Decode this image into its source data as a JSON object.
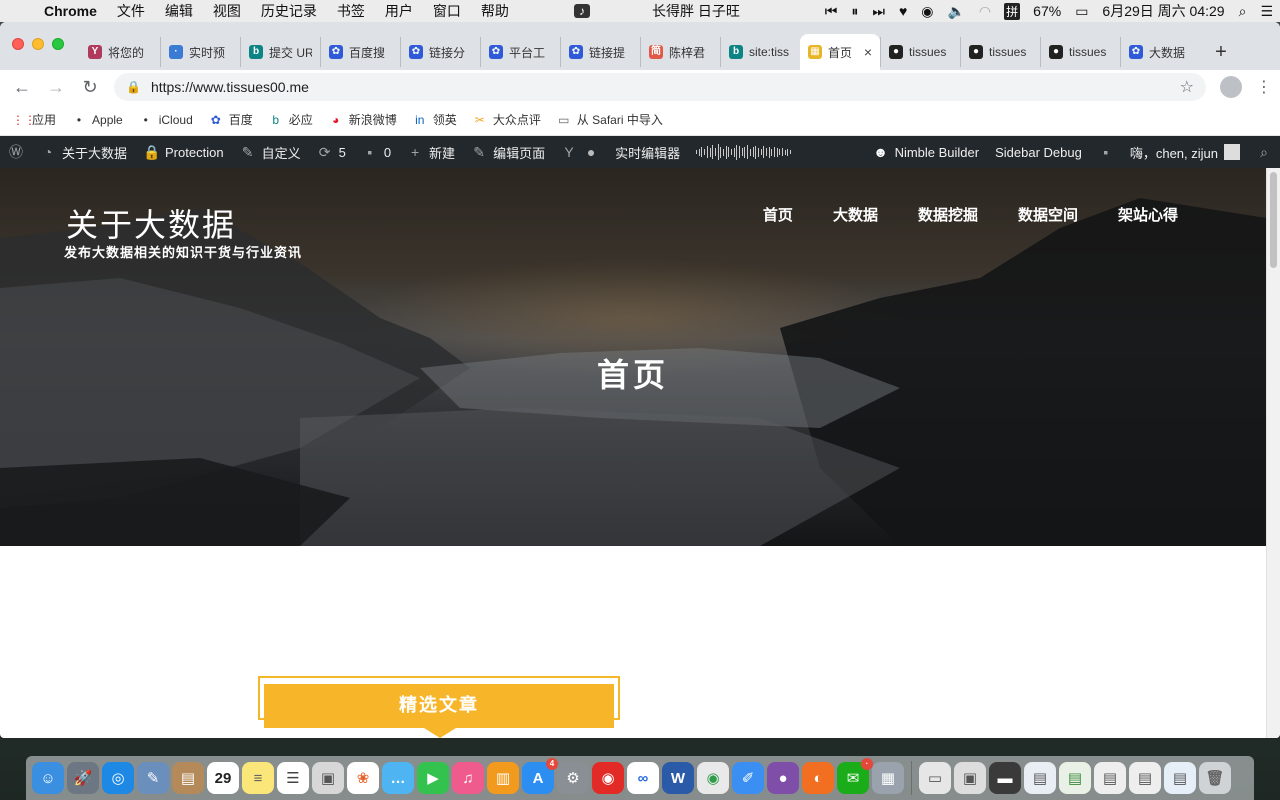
{
  "menubar": {
    "app": "Chrome",
    "menus": [
      "文件",
      "编辑",
      "视图",
      "历史记录",
      "书签",
      "用户",
      "窗口",
      "帮助"
    ],
    "now_playing": "长得胖 日子旺",
    "battery": "67%",
    "date_time": "6月29日 周六  04:29",
    "input_method": "拼"
  },
  "tabs": [
    {
      "title": "将您的",
      "fav": "Y",
      "color": "#b03a5b"
    },
    {
      "title": "实时预",
      "fav": "·",
      "color": "#3a7bd5"
    },
    {
      "title": "提交 UR",
      "fav": "b",
      "color": "#0c8484"
    },
    {
      "title": "百度搜",
      "fav": "✿",
      "color": "#2f5bd8"
    },
    {
      "title": "链接分",
      "fav": "✿",
      "color": "#2f5bd8"
    },
    {
      "title": "平台工",
      "fav": "✿",
      "color": "#2f5bd8"
    },
    {
      "title": "链接提",
      "fav": "✿",
      "color": "#2f5bd8"
    },
    {
      "title": "陈梓君",
      "fav": "简",
      "color": "#e05a47"
    },
    {
      "title": "site:tiss",
      "fav": "b",
      "color": "#0c8484"
    },
    {
      "title": "首页",
      "fav": "▦",
      "color": "#e8b527",
      "active": true
    },
    {
      "title": "tissues",
      "fav": "●",
      "color": "#222"
    },
    {
      "title": "tissues",
      "fav": "●",
      "color": "#222"
    },
    {
      "title": "tissues",
      "fav": "●",
      "color": "#222"
    },
    {
      "title": "大数据",
      "fav": "✿",
      "color": "#2f5bd8"
    }
  ],
  "omnibox": {
    "url": "https://www.tissues00.me"
  },
  "bookmarks": [
    {
      "label": "应用",
      "icon": "apps-icon"
    },
    {
      "label": "Apple",
      "icon": "apple-icon"
    },
    {
      "label": "iCloud",
      "icon": "apple-icon"
    },
    {
      "label": "百度",
      "icon": "baidu-icon"
    },
    {
      "label": "必应",
      "icon": "bing-icon"
    },
    {
      "label": "新浪微博",
      "icon": "weibo-icon"
    },
    {
      "label": "领英",
      "icon": "linkedin-icon"
    },
    {
      "label": "大众点评",
      "icon": "dianping-icon"
    },
    {
      "label": "从 Safari 中导入",
      "icon": "folder-icon"
    }
  ],
  "adminbar": {
    "site": "关于大数据",
    "protection": "Protection",
    "customize": "自定义",
    "updates": "5",
    "comments": "0",
    "new": "新建",
    "edit_page": "编辑页面",
    "live_editor": "实时编辑器",
    "nimble": "Nimble Builder",
    "sidebar_debug": "Sidebar Debug",
    "greeting": "嗨，chen, zijun"
  },
  "site": {
    "title": "关于大数据",
    "description": "发布大数据相关的知识干货与行业资讯",
    "nav": [
      "首页",
      "大数据",
      "数据挖掘",
      "数据空间",
      "架站心得"
    ],
    "hero_title": "首页",
    "featured": "精选文章"
  },
  "dock": [
    {
      "name": "finder",
      "color": "#3b8fe0",
      "glyph": "☺"
    },
    {
      "name": "launchpad",
      "color": "#6d7783",
      "glyph": "🚀"
    },
    {
      "name": "safari",
      "color": "#1e88e5",
      "glyph": "◎"
    },
    {
      "name": "preview",
      "color": "#6a8fbd",
      "glyph": "✎"
    },
    {
      "name": "contacts",
      "color": "#b48a5a",
      "glyph": "▤"
    },
    {
      "name": "calendar",
      "color": "#ffffff",
      "glyph": "29",
      "text": "#222"
    },
    {
      "name": "notes",
      "color": "#fbe67a",
      "glyph": "≡",
      "text": "#666"
    },
    {
      "name": "reminders",
      "color": "#ffffff",
      "glyph": "☰",
      "text": "#444"
    },
    {
      "name": "photo-booth",
      "color": "#d7d7d7",
      "glyph": "▣",
      "text": "#555"
    },
    {
      "name": "photos",
      "color": "#ffffff",
      "glyph": "❀",
      "text": "#e8632b"
    },
    {
      "name": "messages",
      "color": "#4fb5f2",
      "glyph": "…"
    },
    {
      "name": "facetime",
      "color": "#33c24d",
      "glyph": "▶"
    },
    {
      "name": "itunes",
      "color": "#f05b8e",
      "glyph": "♫"
    },
    {
      "name": "ibooks",
      "color": "#f29a1d",
      "glyph": "▥"
    },
    {
      "name": "app-store",
      "color": "#2c8ef1",
      "glyph": "A",
      "badge": "4"
    },
    {
      "name": "system-preferences",
      "color": "#8a8f95",
      "glyph": "⚙"
    },
    {
      "name": "netease-music",
      "color": "#e22b26",
      "glyph": "◉"
    },
    {
      "name": "baidu-netdisk",
      "color": "#ffffff",
      "glyph": "∞",
      "text": "#2b6de0"
    },
    {
      "name": "word",
      "color": "#2b5aa8",
      "glyph": "W"
    },
    {
      "name": "chrome",
      "color": "#e9e9e9",
      "glyph": "◉",
      "text": "#2f9c4a"
    },
    {
      "name": "pages",
      "color": "#3c8ff2",
      "glyph": "✐"
    },
    {
      "name": "github-desktop",
      "color": "#7f4ea8",
      "glyph": "●"
    },
    {
      "name": "firefox",
      "color": "#f26f21",
      "glyph": "◐"
    },
    {
      "name": "wechat",
      "color": "#1aad19",
      "glyph": "✉",
      "badge": "·"
    },
    {
      "name": "image-capture",
      "color": "#9aa3ad",
      "glyph": "▦"
    },
    {
      "name": "sep"
    },
    {
      "name": "window-thumb-1",
      "color": "#e6e6e6",
      "glyph": "▭",
      "text": "#555"
    },
    {
      "name": "window-thumb-2",
      "color": "#dddddd",
      "glyph": "▣",
      "text": "#555"
    },
    {
      "name": "window-thumb-3",
      "color": "#3a3a3a",
      "glyph": "▬"
    },
    {
      "name": "window-thumb-4",
      "color": "#e9eef5",
      "glyph": "▤",
      "text": "#555"
    },
    {
      "name": "window-thumb-5",
      "color": "#e9f1e7",
      "glyph": "▤",
      "text": "#3a8a3a"
    },
    {
      "name": "window-thumb-6",
      "color": "#eeeeee",
      "glyph": "▤",
      "text": "#555"
    },
    {
      "name": "window-thumb-7",
      "color": "#eeeeee",
      "glyph": "▤",
      "text": "#555"
    },
    {
      "name": "window-thumb-8",
      "color": "#e6eef8",
      "glyph": "▤",
      "text": "#555"
    },
    {
      "name": "trash",
      "color": "#cfd3d6",
      "glyph": "🗑",
      "text": "#666"
    }
  ]
}
